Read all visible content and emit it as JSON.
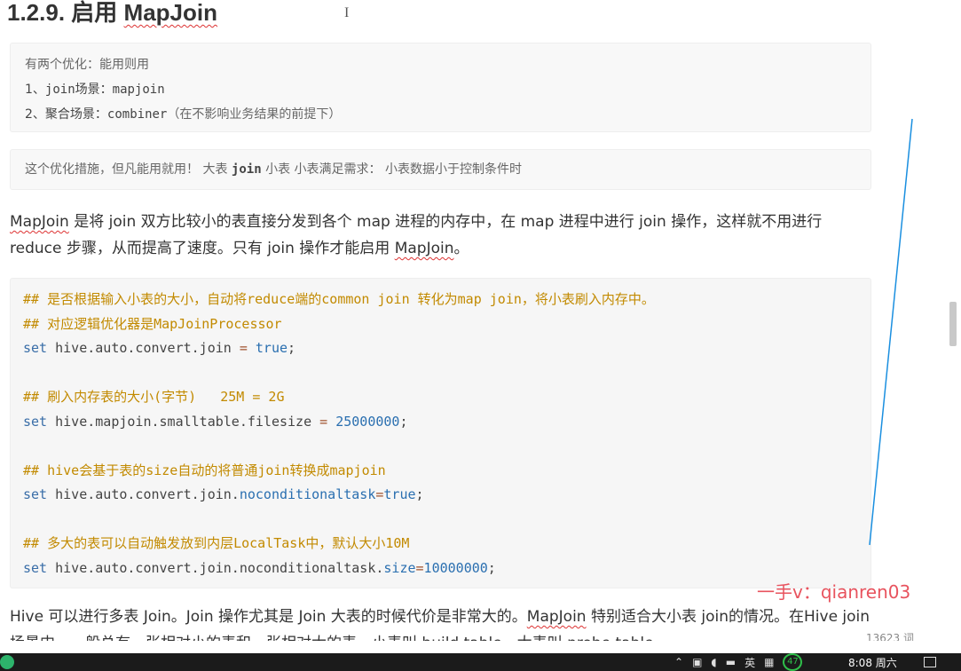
{
  "heading": {
    "number": "1.2.9.",
    "text_a": "启用 ",
    "text_b": "MapJoin"
  },
  "quote1": {
    "line1": "有两个优化：能用则用",
    "line2_prefix": "1、",
    "line2_code1": "join",
    "line2_mid": "场景：",
    "line2_code2": "mapjoin",
    "line3_prefix": "2、聚合场景：",
    "line3_code": "combiner",
    "line3_suffix": "（在不影响业务结果的前提下）"
  },
  "quote2": {
    "part1": "这个优化措施，但凡能用就用！   大表 ",
    "code": "join",
    "part2": " 小表   小表满足需求：  小表数据小于控制条件时"
  },
  "para1": {
    "w1": "MapJoin",
    "t1": " 是将 join 双方比较小的表直接分发到各个 map 进程的内存中，在 map 进程中进行 join 操作，这样就不用进行 reduce 步骤，从而提高了速度。只有 join 操作才能启用 ",
    "w2": "MapJoin",
    "t2": "。"
  },
  "code": {
    "c1": "## 是否根据输入小表的大小，自动将reduce端的common join 转化为map join，将小表刷入内存中。",
    "c2": "## 对应逻辑优化器是MapJoinProcessor",
    "l3_kw": "set",
    "l3_key": " hive.auto.convert.join ",
    "l3_op": "=",
    "l3_val": " true",
    "l3_end": ";",
    "c5": "## 刷入内存表的大小(字节)   25M = 2G",
    "l6_kw": "set",
    "l6_key": " hive.mapjoin.smalltable.filesize ",
    "l6_op": "=",
    "l6_val": " 25000000",
    "l6_end": ";",
    "c8": "## hive会基于表的size自动的将普通join转换成mapjoin",
    "l9_kw": "set",
    "l9_key": " hive.auto.convert.join.",
    "l9_key2": "noconditionaltask",
    "l9_op": "=",
    "l9_val": "true",
    "l9_end": ";",
    "c11": "## 多大的表可以自动触发放到内层LocalTask中，默认大小10M",
    "l12_kw": "set",
    "l12_key": " hive.auto.convert.join.noconditionaltask.",
    "l12_key2": "size",
    "l12_op": "=",
    "l12_val": "10000000",
    "l12_end": ";"
  },
  "para2": {
    "t1": "Hive 可以进行多表 Join。Join 操作尤其是 Join 大表的时候代价是非常大的。",
    "w1": "MapJoin",
    "t2": " 特别适合大小表 join的情况。在Hive join场景中，一般总有一张相对小的表和一张相对大的表，小表叫 build table，大表叫 probe table。"
  },
  "watermark": "一手v：qianren03",
  "word_count": "13623 词",
  "taskbar": {
    "ime": "英",
    "badge": "47",
    "clock": "8:08 周六"
  },
  "colors": {
    "comment": "#c28a00",
    "keyword": "#3a6ea8",
    "value": "#2a6fb0",
    "watermark": "#e8535e",
    "pen_line": "#1a8fe0"
  }
}
